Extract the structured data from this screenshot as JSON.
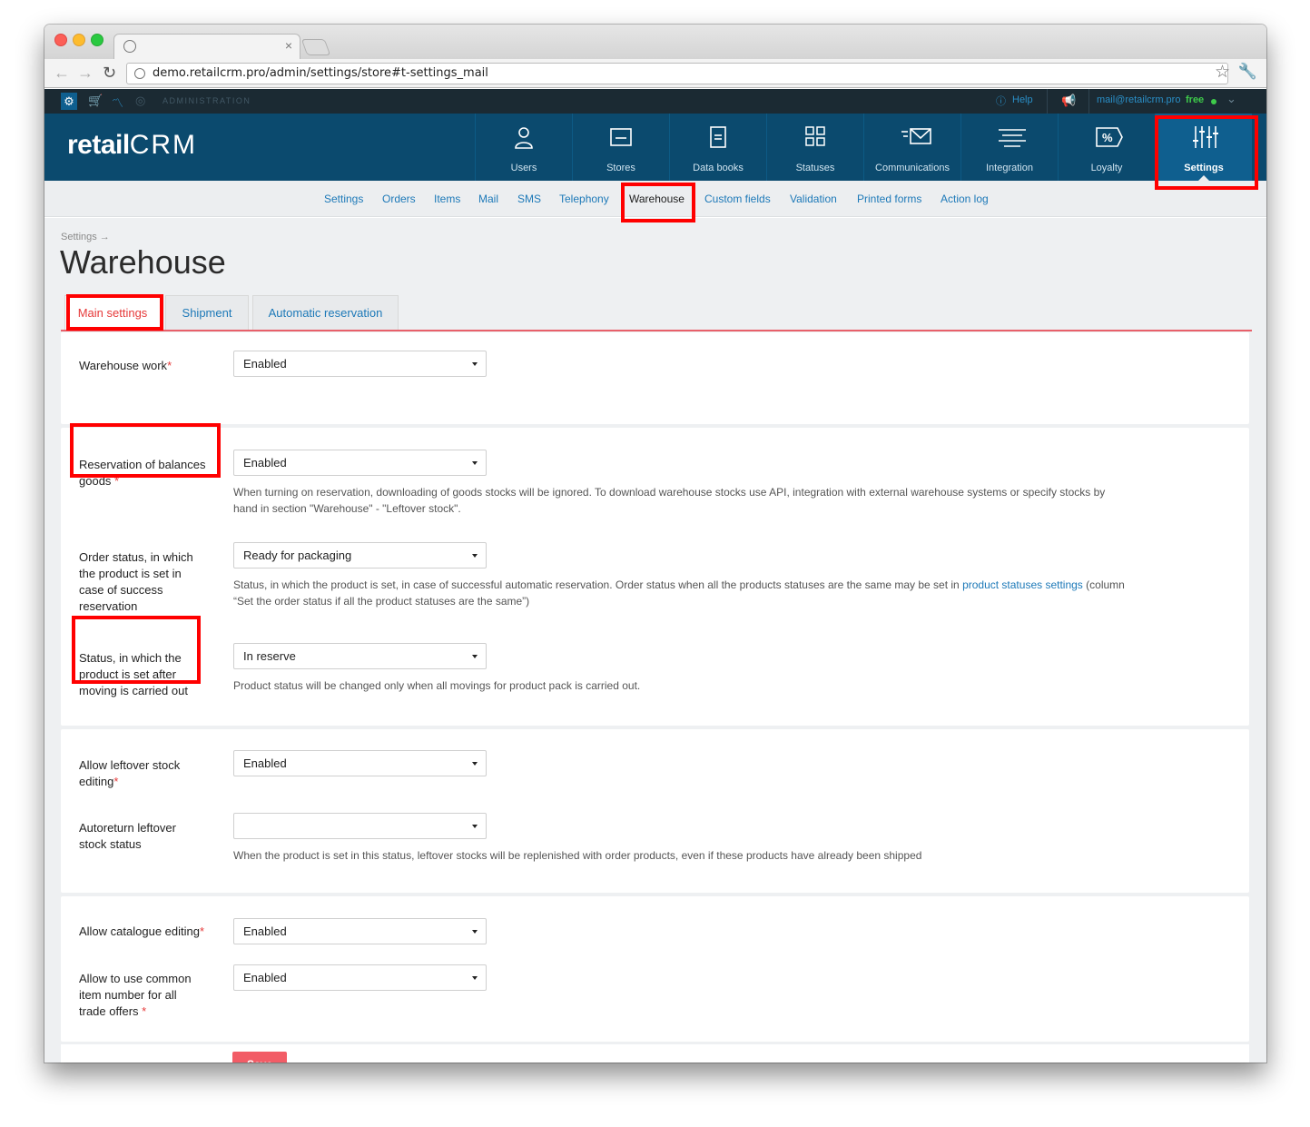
{
  "browser": {
    "url": "demo.retailcrm.pro/admin/settings/store#t-settings_mail",
    "tab_close": "×"
  },
  "admin_bar": {
    "label": "ADMINISTRATION",
    "help": "Help",
    "account": "mail@retailcrm.pro",
    "plan": "free"
  },
  "header": {
    "logo_text": "retail",
    "logo_crm": "CRM",
    "nav": [
      {
        "label": "Users",
        "icon": "user-icon"
      },
      {
        "label": "Stores",
        "icon": "store-icon"
      },
      {
        "label": "Data books",
        "icon": "data-book-icon"
      },
      {
        "label": "Statuses",
        "icon": "statuses-icon"
      },
      {
        "label": "Communications",
        "icon": "mail-icon"
      },
      {
        "label": "Integration",
        "icon": "integration-icon"
      },
      {
        "label": "Loyalty",
        "icon": "percent-icon"
      },
      {
        "label": "Settings",
        "icon": "sliders-icon"
      }
    ],
    "active": "Settings"
  },
  "subnav": {
    "items": [
      "Settings",
      "Orders",
      "Items",
      "Mail",
      "SMS",
      "Telephony",
      "Warehouse",
      "Custom fields",
      "Validation",
      "Printed forms",
      "Action log"
    ],
    "current": "Warehouse"
  },
  "page": {
    "breadcrumb": "Settings →",
    "title": "Warehouse",
    "tabs": [
      "Main settings",
      "Shipment",
      "Automatic reservation"
    ],
    "active_tab": "Main settings"
  },
  "form": {
    "warehouse_work": {
      "label": "Warehouse work",
      "value": "Enabled"
    },
    "reservation": {
      "label_line1": "Reservation of balances",
      "label_line2": "goods",
      "value": "Enabled",
      "hint_line1": "When turning on reservation, downloading of goods stocks will be ignored. To download warehouse stocks use API, integration with external warehouse systems or specify stocks by",
      "hint_line2": "hand in section \"Warehouse\" - \"Leftover stock\"."
    },
    "order_status": {
      "label_lines": [
        "Order status, in which",
        "the product is set in",
        "case of success",
        "reservation"
      ],
      "value": "Ready for packaging",
      "hint_line1_a": "Status, in which the product is set, in case of successful automatic reservation. Order status when all the products statuses are the same may be set in ",
      "hint_link": "product statuses settings",
      "hint_line1_b": " (column",
      "hint_line2": "“Set the order status if all the product statuses are the same”)"
    },
    "moving_status": {
      "label_lines": [
        "Status, in which the",
        "product is set after",
        "moving is carried out"
      ],
      "value": "In reserve",
      "hint": "Product status will be changed only when all movings for product pack is carried out."
    },
    "leftover_editing": {
      "label_line1": "Allow leftover stock",
      "label_line2": "editing",
      "value": "Enabled"
    },
    "autoreturn": {
      "label_line1": "Autoreturn leftover",
      "label_line2": "stock status",
      "value": "",
      "hint": "When the product is set in this status, leftover stocks will be replenished with order products, even if these products have already been shipped"
    },
    "catalogue_editing": {
      "label": "Allow catalogue editing",
      "value": "Enabled"
    },
    "common_item_number": {
      "label_lines": [
        "Allow to use common",
        "item number for all",
        "trade offers"
      ],
      "value": "Enabled"
    },
    "required_mark": "*",
    "save_label": "Save"
  },
  "colors": {
    "header_bg": "#0b4a6e",
    "active_nav_bg": "#0f5f8f",
    "link": "#1d79b8",
    "accent_red": "#e63a3a",
    "save_bg": "#f25c66",
    "annotation_red": "#ff0000"
  }
}
